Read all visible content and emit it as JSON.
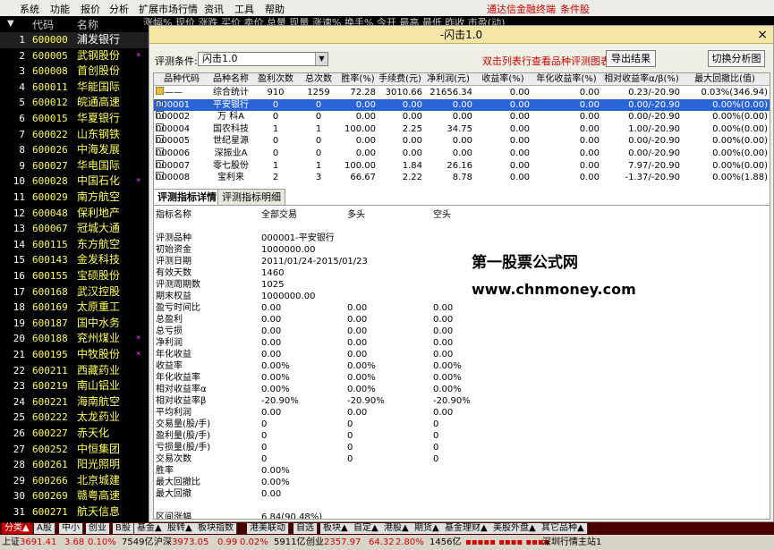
{
  "menu": [
    "系统",
    "功能",
    "报价",
    "分析",
    "扩展市场行情",
    "资讯",
    "工具",
    "帮助"
  ],
  "menu_title": "通达信金融终端",
  "menu_title2": "条件股",
  "list_header": {
    "code": "代码",
    "name": "名称"
  },
  "header_strip": "涨幅% 现价 涨跌 买价 卖价 总量 现量 涨速% 换手% 今开 最高 最低 昨收 市盈(动)",
  "stocks": [
    {
      "n": "1",
      "code": "600000",
      "name": "浦发银行",
      "mark": ""
    },
    {
      "n": "2",
      "code": "600005",
      "name": "武钢股份",
      "mark": "×"
    },
    {
      "n": "3",
      "code": "600008",
      "name": "首创股份",
      "mark": ""
    },
    {
      "n": "4",
      "code": "600011",
      "name": "华能国际",
      "mark": ""
    },
    {
      "n": "5",
      "code": "600012",
      "name": "皖通高速",
      "mark": ""
    },
    {
      "n": "6",
      "code": "600015",
      "name": "华夏银行",
      "mark": ""
    },
    {
      "n": "7",
      "code": "600022",
      "name": "山东钢铁",
      "mark": ""
    },
    {
      "n": "8",
      "code": "600026",
      "name": "中海发展",
      "mark": ""
    },
    {
      "n": "9",
      "code": "600027",
      "name": "华电国际",
      "mark": ""
    },
    {
      "n": "10",
      "code": "600028",
      "name": "中国石化",
      "mark": "×"
    },
    {
      "n": "11",
      "code": "600029",
      "name": "南方航空",
      "mark": ""
    },
    {
      "n": "12",
      "code": "600048",
      "name": "保利地产",
      "mark": ""
    },
    {
      "n": "13",
      "code": "600067",
      "name": "冠城大通",
      "mark": ""
    },
    {
      "n": "14",
      "code": "600115",
      "name": "东方航空",
      "mark": ""
    },
    {
      "n": "15",
      "code": "600143",
      "name": "金发科技",
      "mark": ""
    },
    {
      "n": "16",
      "code": "600155",
      "name": "宝硕股份",
      "mark": ""
    },
    {
      "n": "17",
      "code": "600168",
      "name": "武汉控股",
      "mark": ""
    },
    {
      "n": "18",
      "code": "600169",
      "name": "太原重工",
      "mark": ""
    },
    {
      "n": "19",
      "code": "600187",
      "name": "国中水务",
      "mark": ""
    },
    {
      "n": "20",
      "code": "600188",
      "name": "兖州煤业",
      "mark": "×"
    },
    {
      "n": "21",
      "code": "600195",
      "name": "中牧股份",
      "mark": "×"
    },
    {
      "n": "22",
      "code": "600211",
      "name": "西藏药业",
      "mark": ""
    },
    {
      "n": "23",
      "code": "600219",
      "name": "南山铝业",
      "mark": ""
    },
    {
      "n": "24",
      "code": "600221",
      "name": "海南航空",
      "mark": ""
    },
    {
      "n": "25",
      "code": "600222",
      "name": "太龙药业",
      "mark": ""
    },
    {
      "n": "26",
      "code": "600227",
      "name": "赤天化",
      "mark": ""
    },
    {
      "n": "27",
      "code": "600252",
      "name": "中恒集团",
      "mark": ""
    },
    {
      "n": "28",
      "code": "600261",
      "name": "阳光照明",
      "mark": ""
    },
    {
      "n": "29",
      "code": "600266",
      "name": "北京城建",
      "mark": ""
    },
    {
      "n": "30",
      "code": "600269",
      "name": "赣粤高速",
      "mark": ""
    },
    {
      "n": "31",
      "code": "600271",
      "name": "航天信息",
      "mark": ""
    }
  ],
  "bottom_tabs": [
    "分类▲",
    "A股",
    "中小",
    "创业",
    "B股",
    "基金▲",
    "股转▲",
    "板块指数",
    "港美联动",
    "自选",
    "板块▲",
    "自定▲",
    "港股▲",
    "期货▲",
    "基金理财▲",
    "美股外盘▲",
    "其它品种▲"
  ],
  "status": {
    "sh_label": "上证",
    "sh_val": "3691.41",
    "sh_chg": "3.68",
    "sh_pct": "0.10%",
    "sh_amt": "7549亿",
    "hs_label": "沪深",
    "hs_val": "3973.05",
    "hs_chg": "0.99",
    "hs_pct": "0.02%",
    "hs_amt": "5911亿",
    "cy_label": "创业",
    "cy_val": "2357.97",
    "cy_chg": "64.32",
    "cy_pct": "2.80%",
    "cy_amt": "1456亿",
    "right": "深圳行情主站1"
  },
  "dialog": {
    "title": "-闪击1.0",
    "close": "×",
    "cond_label": "评测条件:",
    "cond_value": "闪击1.0",
    "hint": "双击列表行查看品种评测图表",
    "export_btn": "导出结果",
    "switch_btn": "切换分析图",
    "columns": [
      "品种代码",
      "品种名称",
      "盈利次数",
      "总次数",
      "胜率(%)",
      "手续费(元)",
      "净利润(元)",
      "收益率(%)",
      "年化收益率(%)",
      "相对收益率α/β(%)",
      "最大回撤比(值)"
    ],
    "rows": [
      {
        "code": "———",
        "name": "综合统计",
        "win": "910",
        "total": "1259",
        "rate": "72.28",
        "fee": "3010.66",
        "profit": "21656.34",
        "ret": "0.00",
        "annual": "0.00",
        "rel": "0.23/-20.90",
        "dd": "0.03%(346.94)",
        "icon": "folder"
      },
      {
        "code": "000001",
        "name": "平安银行",
        "win": "0",
        "total": "0",
        "rate": "0.00",
        "fee": "0.00",
        "profit": "0.00",
        "ret": "0.00",
        "annual": "0.00",
        "rel": "0.00/-20.90",
        "dd": "0.00%(0.00)",
        "icon": "doc"
      },
      {
        "code": "000002",
        "name": "万 科A",
        "win": "0",
        "total": "0",
        "rate": "0.00",
        "fee": "0.00",
        "profit": "0.00",
        "ret": "0.00",
        "annual": "0.00",
        "rel": "0.00/-20.90",
        "dd": "0.00%(0.00)",
        "icon": "doc"
      },
      {
        "code": "000004",
        "name": "国农科技",
        "win": "1",
        "total": "1",
        "rate": "100.00",
        "fee": "2.25",
        "profit": "34.75",
        "ret": "0.00",
        "annual": "0.00",
        "rel": "1.00/-20.90",
        "dd": "0.00%(0.00)",
        "icon": "doc"
      },
      {
        "code": "000005",
        "name": "世纪星源",
        "win": "0",
        "total": "0",
        "rate": "0.00",
        "fee": "0.00",
        "profit": "0.00",
        "ret": "0.00",
        "annual": "0.00",
        "rel": "0.00/-20.90",
        "dd": "0.00%(0.00)",
        "icon": "doc"
      },
      {
        "code": "000006",
        "name": "深振业A",
        "win": "0",
        "total": "0",
        "rate": "0.00",
        "fee": "0.00",
        "profit": "0.00",
        "ret": "0.00",
        "annual": "0.00",
        "rel": "0.00/-20.90",
        "dd": "0.00%(0.00)",
        "icon": "doc"
      },
      {
        "code": "000007",
        "name": "零七股份",
        "win": "1",
        "total": "1",
        "rate": "100.00",
        "fee": "1.84",
        "profit": "26.16",
        "ret": "0.00",
        "annual": "0.00",
        "rel": "7.97/-20.90",
        "dd": "0.00%(0.00)",
        "icon": "doc"
      },
      {
        "code": "000008",
        "name": "宝利来",
        "win": "2",
        "total": "3",
        "rate": "66.67",
        "fee": "2.22",
        "profit": "8.78",
        "ret": "0.00",
        "annual": "0.00",
        "rel": "-1.37/-20.90",
        "dd": "0.00%(1.88)",
        "icon": "doc"
      }
    ],
    "tabs": [
      "评测指标详情",
      "评测指标明细"
    ],
    "detail_header": [
      "指标名称",
      "全部交易",
      "多头",
      "空头"
    ],
    "detail": [
      {
        "k": "评测品种",
        "a": "000001-平安银行",
        "b": "",
        "c": ""
      },
      {
        "k": "初始资金",
        "a": "1000000.00",
        "b": "",
        "c": ""
      },
      {
        "k": "评测日期",
        "a": "2011/01/24-2015/01/23",
        "b": "",
        "c": ""
      },
      {
        "k": "有效天数",
        "a": "1460",
        "b": "",
        "c": ""
      },
      {
        "k": "评测周期数",
        "a": "1025",
        "b": "",
        "c": ""
      },
      {
        "k": "期末权益",
        "a": "1000000.00",
        "b": "",
        "c": ""
      },
      {
        "k": "盈亏时间比",
        "a": "0.00",
        "b": "0.00",
        "c": "0.00"
      },
      {
        "k": "总盈利",
        "a": "0.00",
        "b": "0.00",
        "c": "0.00"
      },
      {
        "k": "总亏损",
        "a": "0.00",
        "b": "0.00",
        "c": "0.00"
      },
      {
        "k": "净利润",
        "a": "0.00",
        "b": "0.00",
        "c": "0.00"
      },
      {
        "k": "年化收益",
        "a": "0.00",
        "b": "0.00",
        "c": "0.00"
      },
      {
        "k": "收益率",
        "a": "0.00%",
        "b": "0.00%",
        "c": "0.00%"
      },
      {
        "k": "年化收益率",
        "a": "0.00%",
        "b": "0.00%",
        "c": "0.00%"
      },
      {
        "k": "相对收益率α",
        "a": "0.00%",
        "b": "0.00%",
        "c": "0.00%"
      },
      {
        "k": "相对收益率β",
        "a": "-20.90%",
        "b": "-20.90%",
        "c": "-20.90%"
      },
      {
        "k": "平均利润",
        "a": "0.00",
        "b": "0.00",
        "c": "0.00"
      },
      {
        "k": "交易量(股/手)",
        "a": "0",
        "b": "0",
        "c": "0"
      },
      {
        "k": "盈利量(股/手)",
        "a": "0",
        "b": "0",
        "c": "0"
      },
      {
        "k": "亏损量(股/手)",
        "a": "0",
        "b": "0",
        "c": "0"
      },
      {
        "k": "交易次数",
        "a": "0",
        "b": "0",
        "c": "0"
      },
      {
        "k": "胜率",
        "a": "0.00%",
        "b": "",
        "c": ""
      },
      {
        "k": "最大回撤比",
        "a": "0.00%",
        "b": "",
        "c": ""
      },
      {
        "k": "最大回撤",
        "a": "0.00",
        "b": "",
        "c": ""
      },
      {
        "k": "",
        "a": "",
        "b": "",
        "c": ""
      },
      {
        "k": "区间涨幅",
        "a": "6.84(90.48%)",
        "b": "",
        "c": ""
      }
    ],
    "watermark1": "第一股票公式网",
    "watermark2": "www.chnmoney.com"
  },
  "colors": {
    "accent_red": "#d00000",
    "stock_code": "#ffff54",
    "selected_row": "#2a63d6",
    "title_bar": "#f3e6a6"
  }
}
